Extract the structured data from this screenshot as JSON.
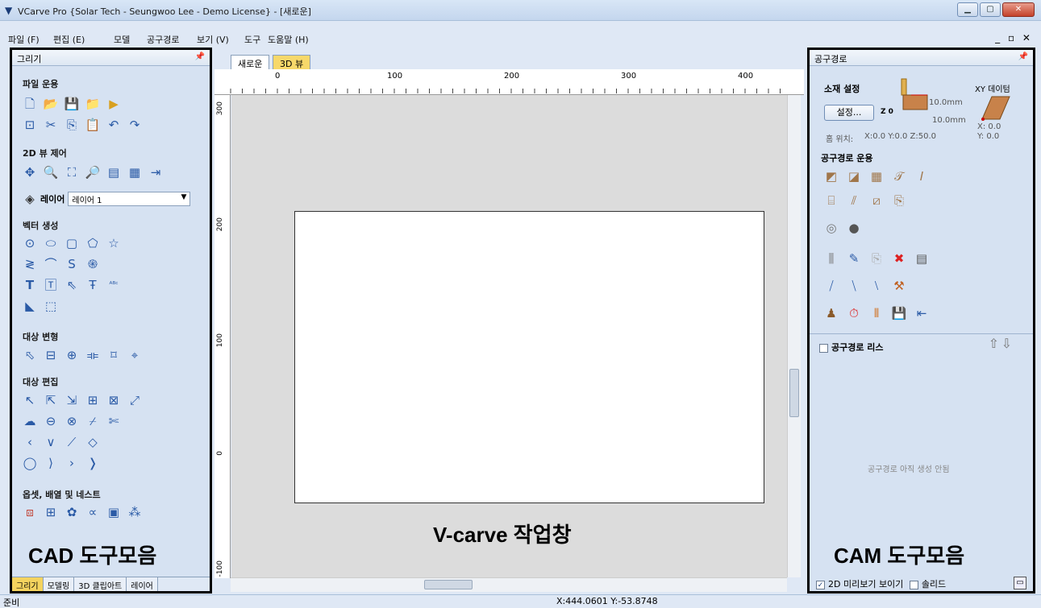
{
  "window": {
    "title": "VCarve Pro {Solar Tech - Seungwoo Lee - Demo License} - [새로운]"
  },
  "menu": {
    "items": [
      "파일 (F)",
      "편집 (E)",
      "모델",
      "공구경로",
      "보기 (V)",
      "도구",
      "도움말 (H)"
    ],
    "mdi_controls": "_ ▫ ✕"
  },
  "left_panel": {
    "title": "그리기",
    "sections": {
      "file": "파일 운용",
      "view2d": "2D 뷰 제어",
      "vector": "벡터 생성",
      "transform": "대상 변형",
      "edit": "대상 편집",
      "offset": "옵셋, 배열 및 네스트"
    },
    "layer_label": "레이어",
    "layer_value": "레이어 1",
    "big_label": "CAD 도구모음",
    "bottom_tabs": [
      "그리기",
      "모델링",
      "3D 클립아트",
      "레이어"
    ]
  },
  "center": {
    "tabs": [
      "새로운",
      "3D 뷰"
    ],
    "ruler_top": [
      "0",
      "100",
      "200",
      "300",
      "400"
    ],
    "ruler_left": [
      "300",
      "200",
      "100",
      "0",
      "-100"
    ],
    "workspace_label": "V-carve 작업창"
  },
  "right_panel": {
    "title": "공구경로",
    "material_title": "소재 설정",
    "setup_button": "설정...",
    "z0": "Z 0",
    "thickness_top": "10.0mm",
    "thickness_bottom": "10.0mm",
    "home_label": "홈 위치:",
    "home_value": "X:0.0 Y:0.0 Z:50.0",
    "xy_datum": "XY 데이텀",
    "x_value": "X: 0.0",
    "y_value": "Y: 0.0",
    "ops_title": "공구경로 운용",
    "list_title": "공구경로 리스",
    "empty_text": "공구경로 아직 생성 안됨",
    "preview_label": "2D 미리보기 보이기",
    "solid_label": "솔리드",
    "big_label": "CAM 도구모음"
  },
  "status": {
    "left": "준비",
    "coords": "X:444.0601 Y:-53.8748"
  }
}
